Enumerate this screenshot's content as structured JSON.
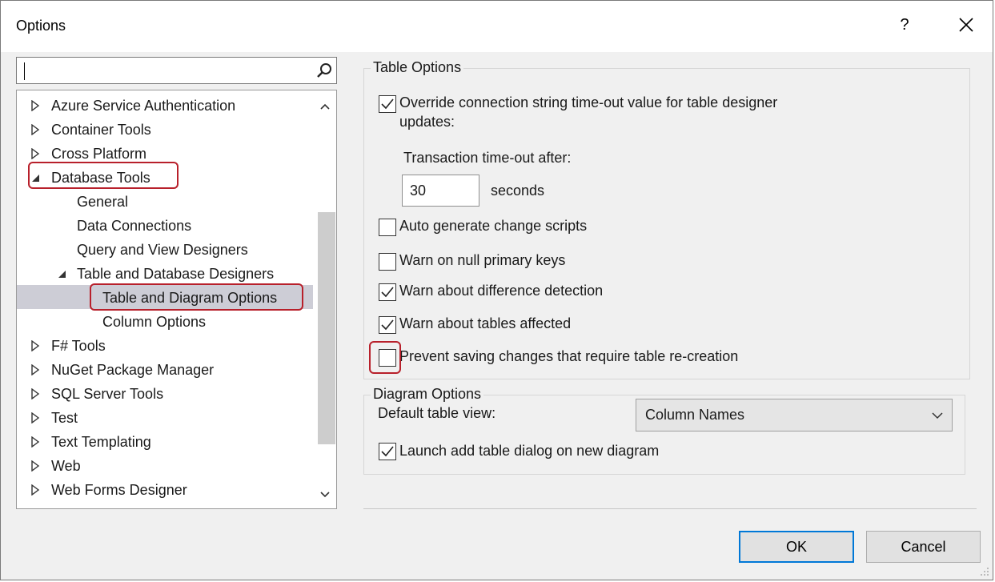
{
  "window": {
    "title": "Options",
    "help": "?"
  },
  "search": {
    "value": "",
    "placeholder": ""
  },
  "tree": {
    "items": [
      {
        "label": "Azure Service Authentication",
        "level": 0,
        "state": "collapsed"
      },
      {
        "label": "Container Tools",
        "level": 0,
        "state": "collapsed"
      },
      {
        "label": "Cross Platform",
        "level": 0,
        "state": "collapsed"
      },
      {
        "label": "Database Tools",
        "level": 0,
        "state": "expanded"
      },
      {
        "label": "General",
        "level": 1,
        "state": "leaf"
      },
      {
        "label": "Data Connections",
        "level": 1,
        "state": "leaf"
      },
      {
        "label": "Query and View Designers",
        "level": 1,
        "state": "leaf"
      },
      {
        "label": "Table and Database Designers",
        "level": 1,
        "state": "expanded"
      },
      {
        "label": "Table and Diagram Options",
        "level": 2,
        "state": "leaf",
        "selected": true
      },
      {
        "label": "Column Options",
        "level": 2,
        "state": "leaf"
      },
      {
        "label": "F# Tools",
        "level": 0,
        "state": "collapsed"
      },
      {
        "label": "NuGet Package Manager",
        "level": 0,
        "state": "collapsed"
      },
      {
        "label": "SQL Server Tools",
        "level": 0,
        "state": "collapsed"
      },
      {
        "label": "Test",
        "level": 0,
        "state": "collapsed"
      },
      {
        "label": "Text Templating",
        "level": 0,
        "state": "collapsed"
      },
      {
        "label": "Web",
        "level": 0,
        "state": "collapsed"
      },
      {
        "label": "Web Forms Designer",
        "level": 0,
        "state": "collapsed"
      }
    ]
  },
  "table_options": {
    "legend": "Table Options",
    "override": {
      "label_line1": "Override connection string time-out value for table designer",
      "label_line2": "updates:",
      "checked": true
    },
    "timeout_label": "Transaction time-out after:",
    "timeout_value": "30",
    "timeout_unit": "seconds",
    "auto_generate": {
      "label": "Auto generate change scripts",
      "checked": false
    },
    "warn_null": {
      "label": "Warn on null primary keys",
      "checked": false
    },
    "warn_difference": {
      "label": "Warn about difference detection",
      "checked": true
    },
    "warn_tables": {
      "label": "Warn about tables affected",
      "checked": true
    },
    "prevent_saving": {
      "label": "Prevent saving changes that require table re-creation",
      "checked": false
    }
  },
  "diagram_options": {
    "legend": "Diagram Options",
    "default_view_label": "Default table view:",
    "default_view_value": "Column Names",
    "launch_add": {
      "label": "Launch add table dialog on new diagram",
      "checked": true
    }
  },
  "buttons": {
    "ok": "OK",
    "cancel": "Cancel"
  },
  "colors": {
    "highlight": "#b8202b",
    "accent": "#0078d7",
    "selection": "#cdcdd6"
  }
}
